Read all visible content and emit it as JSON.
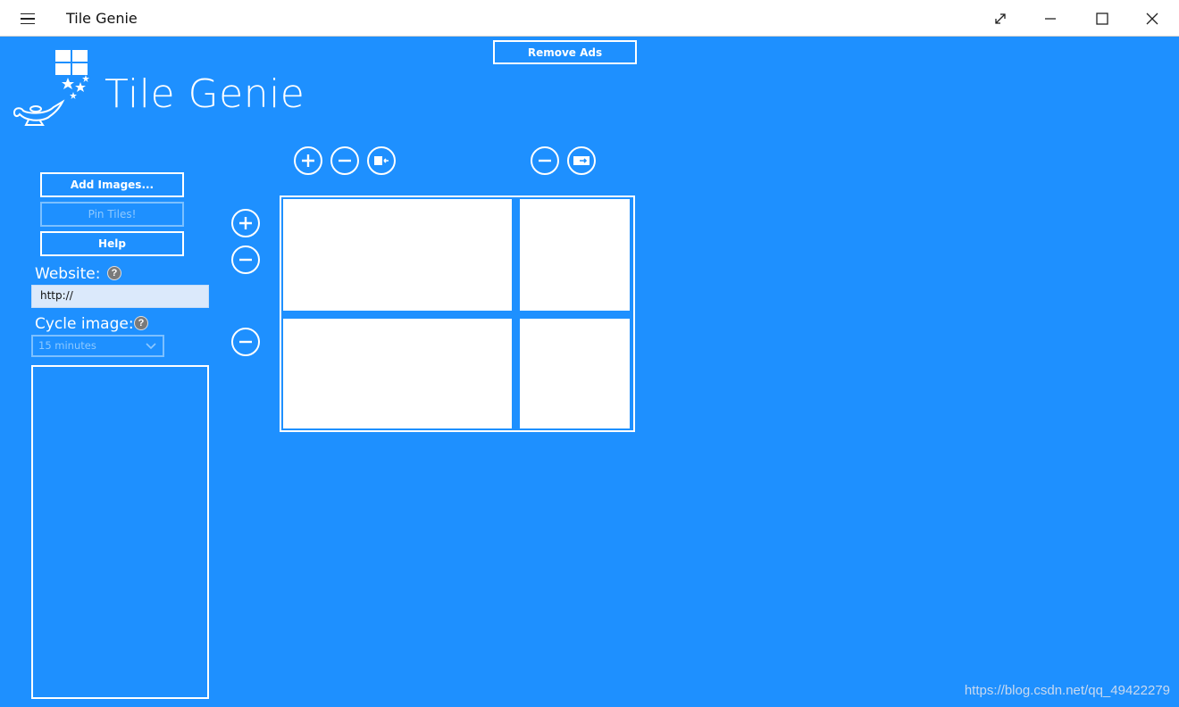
{
  "window": {
    "title": "Tile Genie",
    "menu_icon": "hamburger-icon",
    "controls": [
      "expand-icon",
      "minimize-icon",
      "maximize-icon",
      "close-icon"
    ]
  },
  "header": {
    "remove_ads": "Remove Ads",
    "app_name": "Tile Genie",
    "logo_icon": "genie-lamp-logo"
  },
  "sidebar": {
    "add_images": "Add Images...",
    "pin_tiles": "Pin Tiles!",
    "help": "Help",
    "website_label": "Website:",
    "website_help": "?",
    "website_value": "http://",
    "cycle_label": "Cycle image:",
    "cycle_help": "?",
    "cycle_value": "15 minutes"
  },
  "toolbar_top": {
    "left_icons": [
      "add-column-icon",
      "remove-column-icon",
      "rotate-left-icon"
    ],
    "right_icons": [
      "remove-icon",
      "export-icon"
    ]
  },
  "toolbar_side": {
    "icons": [
      "add-row-icon",
      "remove-row-icon",
      "remove-row-icon"
    ]
  },
  "watermark": "https://blog.csdn.net/qq_49422279",
  "colors": {
    "background": "#1e90ff",
    "foreground": "#ffffff",
    "disabled": "#8ec9ff"
  }
}
